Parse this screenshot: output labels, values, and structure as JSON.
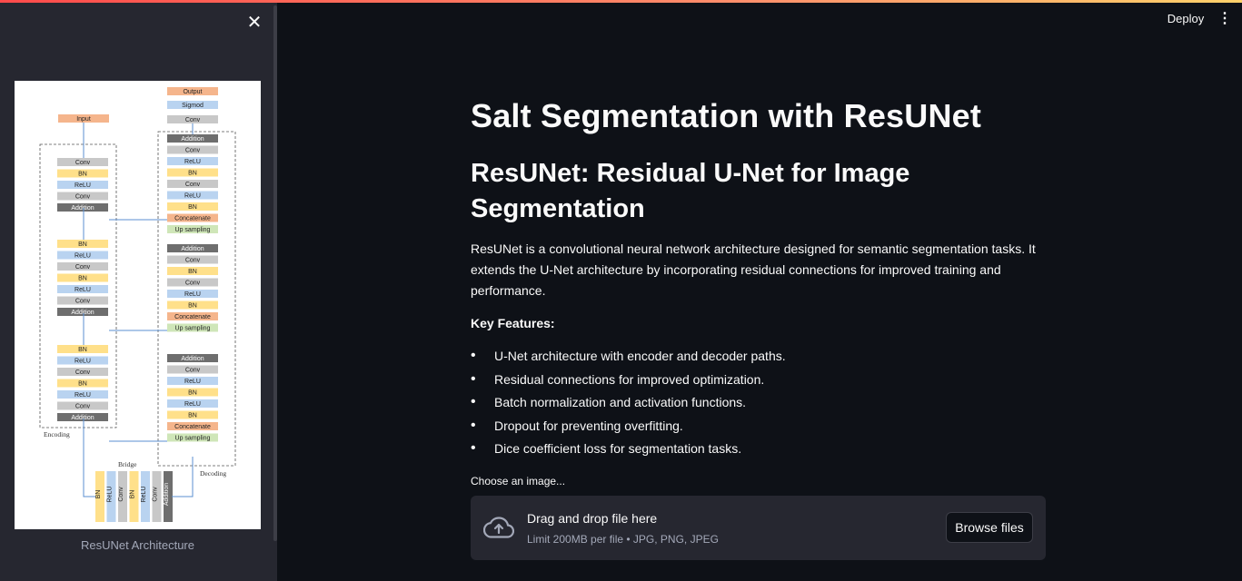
{
  "sidebar": {
    "close_glyph": "✕",
    "image_caption": "ResUNet Architecture",
    "diagram": {
      "input": "Input",
      "output": "Output",
      "sigmoid": "Sigmod",
      "conv": "Conv",
      "bn": "BN",
      "relu": "ReLU",
      "addition": "Addition",
      "concatenate": "Concatenate",
      "upsampling": "Up sampling",
      "encoding": "Encoding",
      "decoding": "Decoding",
      "bridge": "Bridge"
    }
  },
  "header": {
    "deploy_label": "Deploy",
    "menu_glyph": "⋮"
  },
  "main": {
    "title": "Salt Segmentation with ResUNet",
    "subtitle": "ResUNet: Residual U-Net for Image Segmentation",
    "description": "ResUNet is a convolutional neural network architecture designed for semantic segmentation tasks. It extends the U-Net architecture by incorporating residual connections for improved training and performance.",
    "key_features_label": "Key Features:",
    "features": [
      "U-Net architecture with encoder and decoder paths.",
      "Residual connections for improved optimization.",
      "Batch normalization and activation functions.",
      "Dropout for preventing overfitting.",
      "Dice coefficient loss for segmentation tasks."
    ],
    "uploader": {
      "label": "Choose an image...",
      "title": "Drag and drop file here",
      "limit": "Limit 200MB per file • JPG, PNG, JPEG",
      "browse_label": "Browse files"
    }
  },
  "colors": {
    "background": "#0e1117",
    "sidebar": "#262730",
    "accent_start": "#ff4b4b",
    "accent_end": "#ffd16a",
    "block_conv": "#c8c8c8",
    "block_bn": "#ffe08a",
    "block_relu": "#b9d3f0",
    "block_addition": "#6e6e6e",
    "block_concat": "#f5b58c",
    "block_upsampling": "#cfe6b8",
    "block_input": "#f5b58c"
  }
}
